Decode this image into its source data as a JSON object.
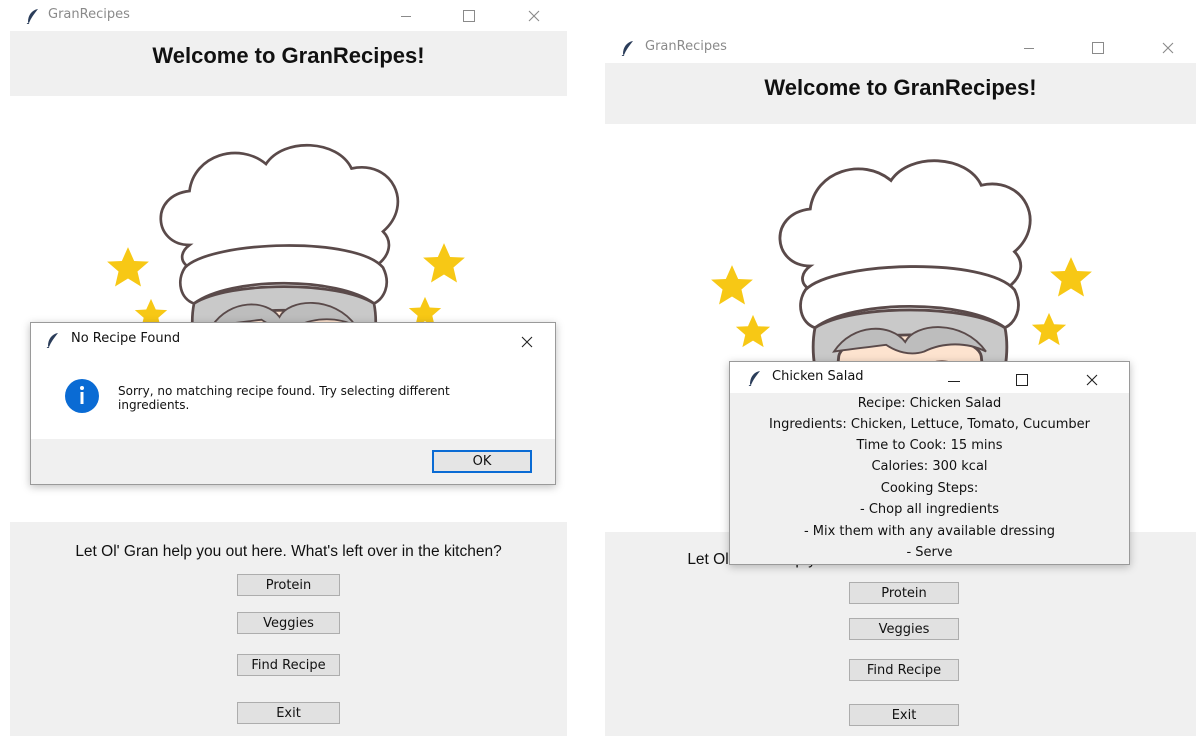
{
  "left_window": {
    "title": "GranRecipes",
    "heading": "Welcome to GranRecipes!",
    "prompt": "Let Ol' Gran help you out here. What's left over in the kitchen?",
    "buttons": {
      "protein": "Protein",
      "veggies": "Veggies",
      "find": "Find Recipe",
      "exit": "Exit"
    }
  },
  "message_dialog": {
    "title": "No Recipe Found",
    "message_line1": "Sorry, no matching recipe found. Try selecting different",
    "message_line2": "ingredients.",
    "ok_label": "OK",
    "icon": "info-icon"
  },
  "right_window": {
    "title": "GranRecipes",
    "heading": "Welcome to GranRecipes!",
    "prompt": "Let Ol' Gran help you out here. What's left over in the kitchen?",
    "buttons": {
      "protein": "Protein",
      "veggies": "Veggies",
      "find": "Find Recipe",
      "exit": "Exit"
    }
  },
  "recipe_popup": {
    "title": "Chicken Salad",
    "lines": [
      "Recipe: Chicken Salad",
      "Ingredients: Chicken, Lettuce, Tomato, Cucumber",
      "Time to Cook: 15 mins",
      "Calories: 300 kcal",
      "Cooking Steps:",
      "- Chop all ingredients",
      "- Mix them with any available dressing",
      "- Serve"
    ]
  },
  "colors": {
    "info_blue": "#0a6bd4",
    "ok_border": "#0a6bd4",
    "star": "#f7c815",
    "window_bg": "#f0f0f0"
  }
}
